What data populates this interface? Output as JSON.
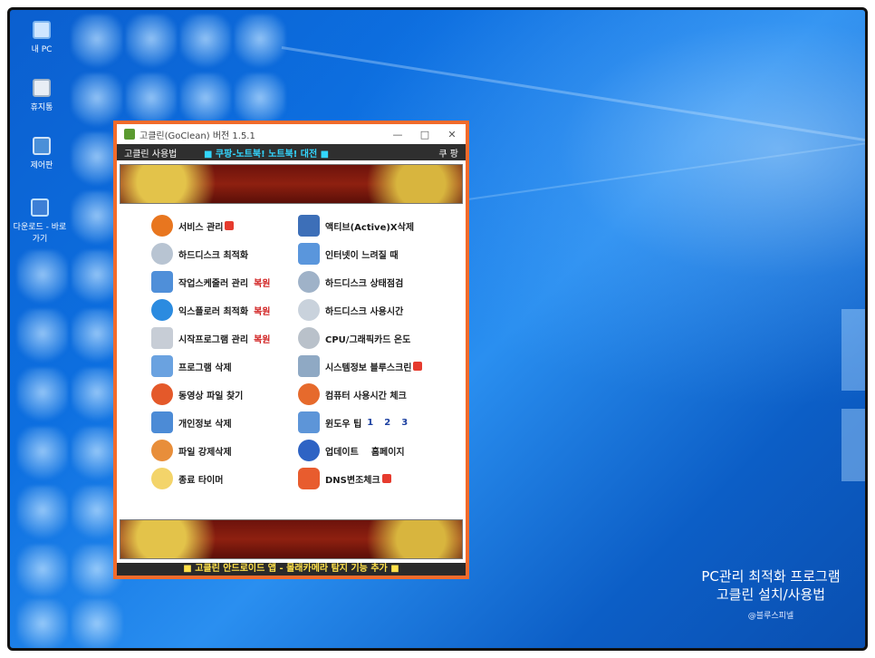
{
  "desktop": {
    "icons": [
      {
        "label": "내 PC",
        "icon": "pc-icon"
      },
      {
        "label": "휴지통",
        "icon": "recycle-bin-icon"
      },
      {
        "label": "제어판",
        "icon": "control-panel-icon"
      },
      {
        "label": "다운로드 - 바로 가기",
        "icon": "download-shortcut-icon"
      }
    ]
  },
  "window": {
    "title": "고클린(GoClean) 버전 1.5.1",
    "controls": {
      "minimize": "—",
      "maximize": "□",
      "close": "✕"
    },
    "menu": {
      "usage": "고클린 사용법",
      "promo": "■ 쿠팡-노트북! 노트북! 대전 ■",
      "shop": "쿠 팡"
    },
    "left_items": [
      {
        "label": "서비스 관리",
        "icon": "gear-icon",
        "badge": "N"
      },
      {
        "label": "하드디스크 최적화",
        "icon": "disk-wrench-icon"
      },
      {
        "label": "작업스케줄러 관리",
        "icon": "scheduler-icon",
        "tag": "복원"
      },
      {
        "label": "익스플로러 최적화",
        "icon": "ie-icon",
        "tag": "복원"
      },
      {
        "label": "시작프로그램 관리",
        "icon": "document-icon",
        "tag": "복원"
      },
      {
        "label": "프로그램 삭제",
        "icon": "checklist-icon"
      },
      {
        "label": "동영상 파일 찾기",
        "icon": "magnifier-icon"
      },
      {
        "label": "개인정보 삭제",
        "icon": "window-arrow-icon"
      },
      {
        "label": "파일 강제삭제",
        "icon": "file-x-icon"
      },
      {
        "label": "종료 타이머",
        "icon": "sleep-timer-icon"
      }
    ],
    "right_items": [
      {
        "label": "액티브(Active)X삭제",
        "icon": "activex-icon"
      },
      {
        "label": "인터넷이 느려질 때",
        "icon": "internet-arrow-icon"
      },
      {
        "label": "하드디스크 상태점검",
        "icon": "disk-search-icon"
      },
      {
        "label": "하드디스크 사용시간",
        "icon": "disk-clock-icon"
      },
      {
        "label": "CPU/그래픽카드 온도",
        "icon": "thermometer-icon"
      },
      {
        "label": "시스템정보 블루스크린",
        "icon": "monitor-icon",
        "badge": "N"
      },
      {
        "label": "컴퓨터 사용시간 체크",
        "icon": "clock-icon"
      },
      {
        "label": "윈도우 팁",
        "icon": "tip-icon",
        "tips": [
          "1",
          "2",
          "3"
        ]
      },
      {
        "label": "업데이트",
        "icon": "update-icon",
        "extra": "홈페이지"
      },
      {
        "label": "DNS변조체크",
        "icon": "shield-icon",
        "badge": "N"
      }
    ],
    "footer": "■ 고클린 안드로이드 앱 - 몰래카메라 탐지 기능 추가 ■"
  },
  "caption": {
    "line1": "PC관리 최적화 프로그램",
    "line2": "고클린 설치/사용법",
    "credit": "@블루스피넬"
  },
  "colors": {
    "accent_border": "#f26b2b",
    "menu_bg": "#2f2f2f",
    "promo_text": "#33d6ff",
    "tag_red": "#d12222",
    "footer_text": "#ffe14a"
  }
}
